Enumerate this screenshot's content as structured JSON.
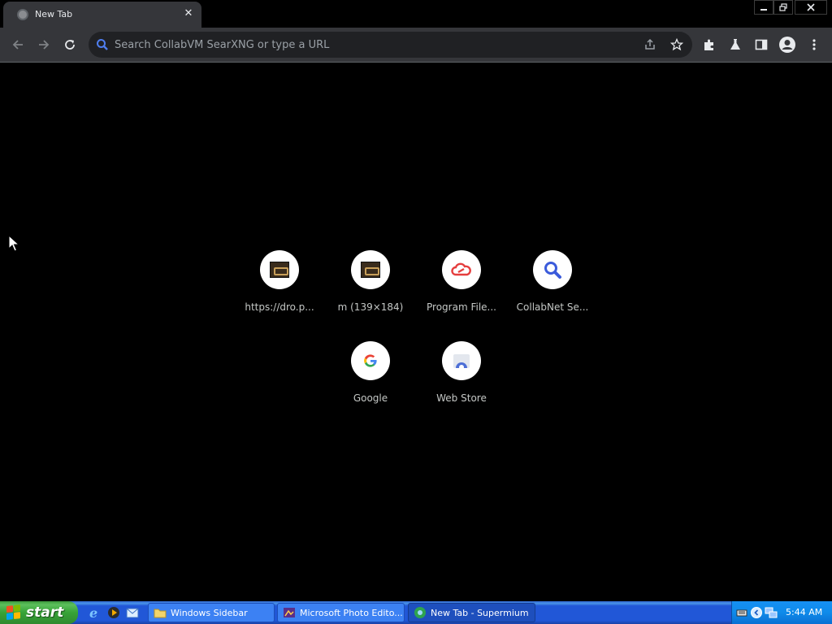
{
  "browser": {
    "tab": {
      "title": "New Tab",
      "close_symbol": "✕",
      "favicon": "globe-icon"
    },
    "window_controls": [
      "minimize-icon",
      "restore-icon",
      "close-icon"
    ],
    "toolbar": {
      "buttons": [
        "back-arrow-icon",
        "forward-arrow-icon",
        "reload-icon"
      ],
      "omnibox": {
        "placeholder": "Search CollabVM SearXNG or type a URL",
        "value": ""
      },
      "actions": [
        "share-icon",
        "bookmark-star-icon",
        "extensions-puzzle-icon",
        "labs-flask-icon",
        "side-panel-icon",
        "profile-icon",
        "menu-kebab-icon"
      ]
    }
  },
  "shortcuts": [
    {
      "label": "https://dro.p...",
      "icon": "image-thumbnail-icon"
    },
    {
      "label": "m (139×184)",
      "icon": "image-thumbnail-icon"
    },
    {
      "label": "Program File...",
      "icon": "cloud-link-icon"
    },
    {
      "label": "CollabNet Se...",
      "icon": "magnifier-icon"
    },
    {
      "label": "Google",
      "icon": "google-g-icon"
    },
    {
      "label": "Web Store",
      "icon": "web-store-icon"
    }
  ],
  "taskbar": {
    "start_label": "start",
    "quick_launch": [
      "internet-explorer-icon",
      "media-player-icon",
      "outlook-express-icon"
    ],
    "tasks": [
      {
        "label": "Windows Sidebar",
        "icon": "folder-icon",
        "active": false
      },
      {
        "label": "Microsoft Photo Edito...",
        "icon": "photo-editor-icon",
        "active": false
      },
      {
        "label": "New Tab - Supermium",
        "icon": "supermium-icon",
        "active": true
      }
    ],
    "tray": {
      "clock": "5:44 AM",
      "icons": [
        "keyboard-icon",
        "chevron-left-icon",
        "network-icon"
      ]
    }
  },
  "colors": {
    "toolbar": "#35363a",
    "omnibox": "#202124",
    "taskbar": "#2157d7",
    "start": "#37a337",
    "tray": "#0f8bea"
  }
}
